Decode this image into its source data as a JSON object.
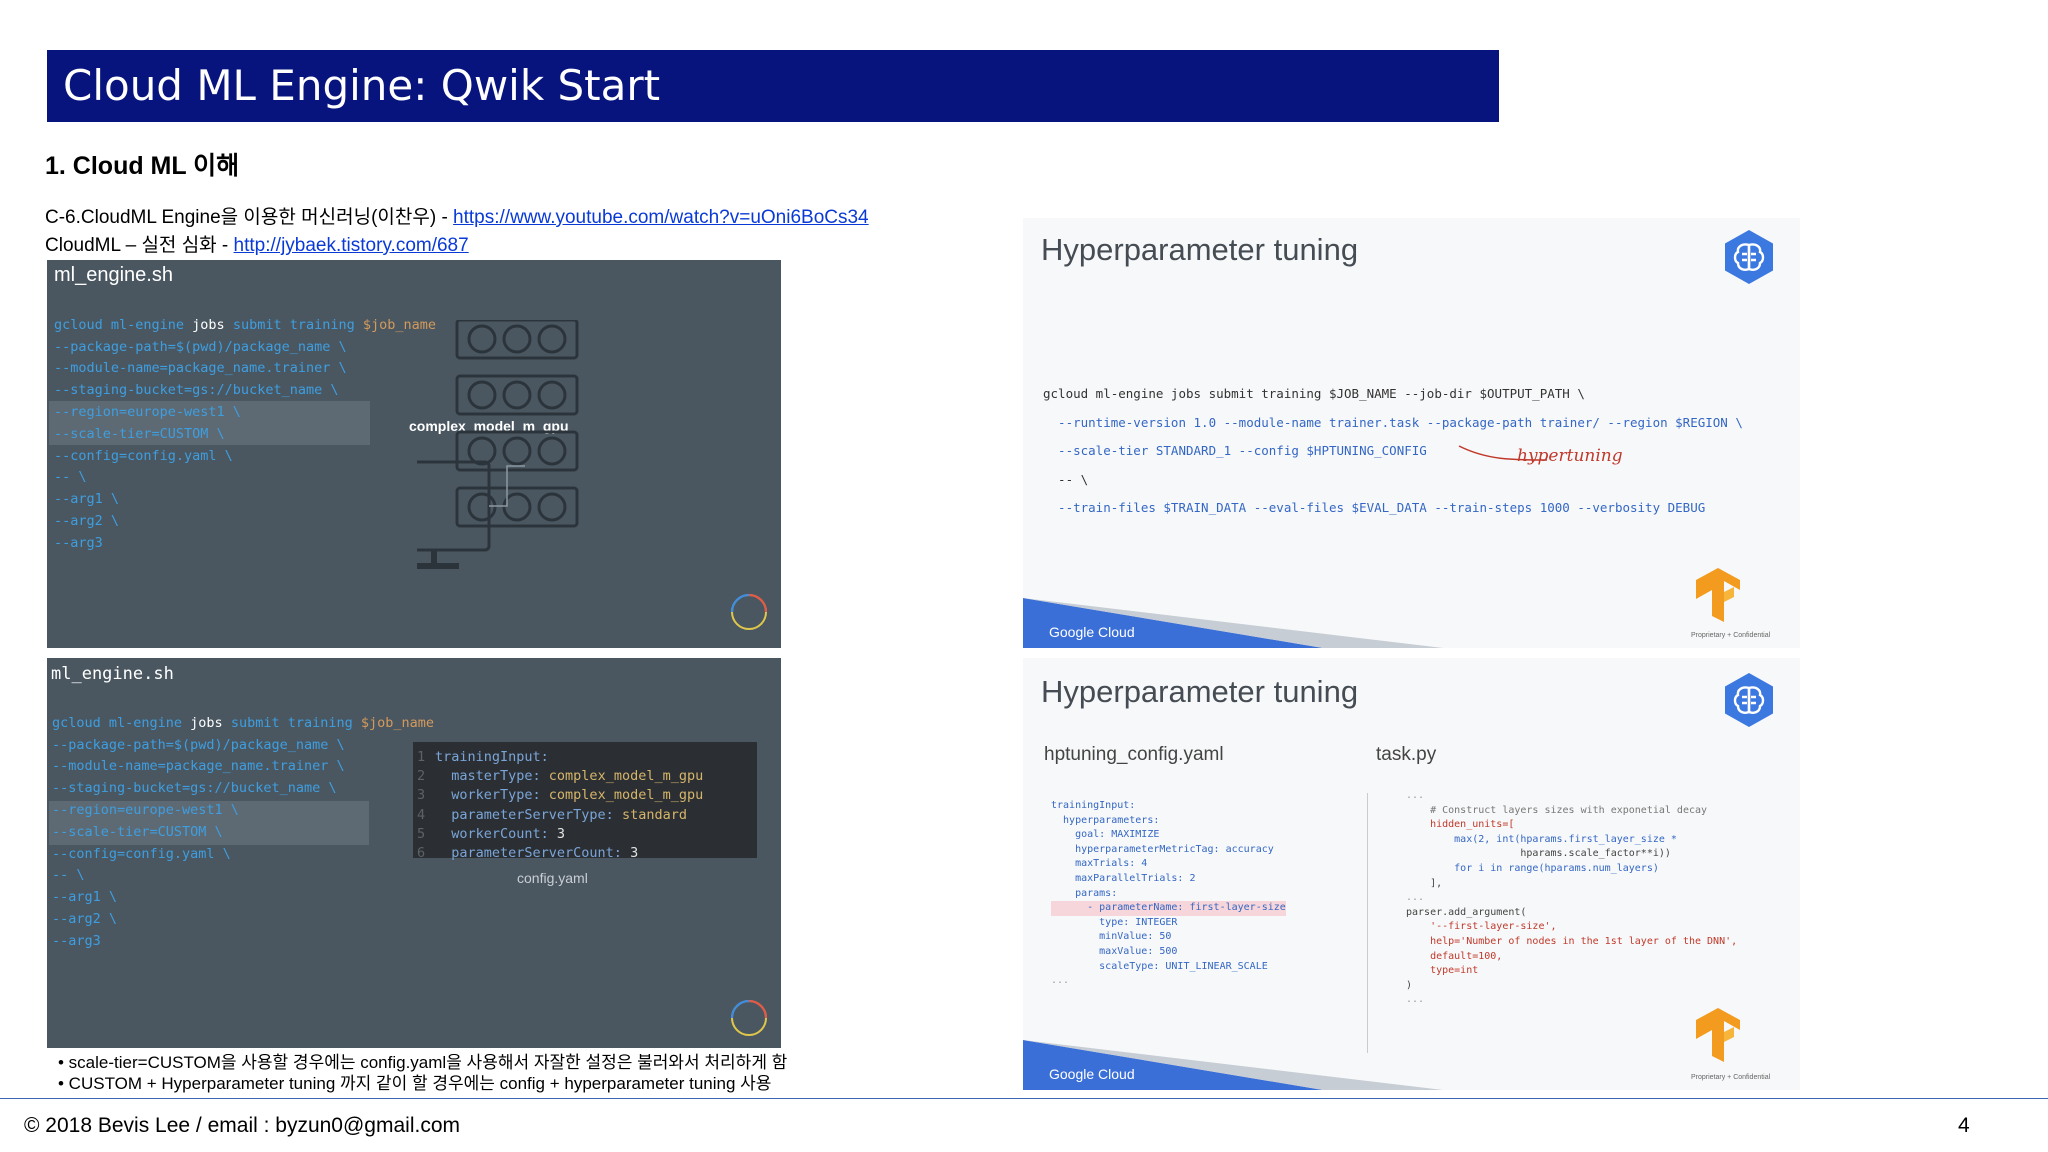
{
  "title": "Cloud ML Engine: Qwik Start",
  "section": "1. Cloud ML 이해",
  "refs": [
    {
      "prefix": "C-6.CloudML Engine을 이용한 머신러닝(이찬우) - ",
      "link": "https://www.youtube.com/watch?v=uOni6BoCs34"
    },
    {
      "prefix": "CloudML – 실전 심화 - ",
      "link": "http://jybaek.tistory.com/687"
    }
  ],
  "panel1": {
    "filename": "ml_engine.sh",
    "lines": [
      {
        "a": "gcloud ml-engine ",
        "w": "jobs",
        "b": " submit training ",
        "v": "$job_name"
      },
      {
        "a": "--package-path=$(pwd)/package_name \\"
      },
      {
        "a": "--module-name=package_name.trainer \\"
      },
      {
        "a": "--staging-bucket=gs://bucket_name \\"
      },
      {
        "a": "--region=europe-west1 \\"
      },
      {
        "a": "--scale-tier=CUSTOM \\"
      },
      {
        "a": "--config=config.yaml \\"
      },
      {
        "a": "-- \\"
      },
      {
        "a": "--arg1 \\"
      },
      {
        "a": "--arg2 \\"
      },
      {
        "a": "--arg3"
      }
    ],
    "machine_label": "complex_model_m_gpu"
  },
  "panel2": {
    "filename": "ml_engine.sh",
    "lines": [
      {
        "a": "gcloud ml-engine ",
        "w": "jobs",
        "b": " submit training ",
        "v": "$job_name"
      },
      {
        "a": "--package-path=$(pwd)/package_name \\"
      },
      {
        "a": "--module-name=package_name.trainer \\"
      },
      {
        "a": "--staging-bucket=gs://bucket_name \\"
      },
      {
        "a": "--region=europe-west1 \\"
      },
      {
        "a": "--scale-tier=CUSTOM \\"
      },
      {
        "a": "--config=config.yaml \\"
      },
      {
        "a": "-- \\"
      },
      {
        "a": "--arg1 \\"
      },
      {
        "a": "--arg2 \\"
      },
      {
        "a": "--arg3"
      }
    ],
    "yaml_lines": [
      {
        "n": "1",
        "k": "trainingInput:",
        "v": ""
      },
      {
        "n": "2",
        "k": "  masterType: ",
        "v": "complex_model_m_gpu"
      },
      {
        "n": "3",
        "k": "  workerType: ",
        "v": "complex_model_m_gpu"
      },
      {
        "n": "4",
        "k": "  parameterServerType: ",
        "v": "standard"
      },
      {
        "n": "5",
        "k": "  workerCount: ",
        "v": "3"
      },
      {
        "n": "6",
        "k": "  parameterServerCount: ",
        "v": "3"
      }
    ],
    "yaml_caption": "config.yaml"
  },
  "slide1": {
    "title": "Hyperparameter tuning",
    "cmd": [
      "gcloud ml-engine jobs submit training $JOB_NAME --job-dir $OUTPUT_PATH \\",
      "  --runtime-version 1.0 --module-name trainer.task --package-path trainer/ --region $REGION \\",
      "  --scale-tier STANDARD_1 --config $HPTUNING_CONFIG",
      "  -- \\",
      "  --train-files $TRAIN_DATA --eval-files $EVAL_DATA --train-steps 1000 --verbosity DEBUG"
    ],
    "annotation": "hypertuning",
    "footer_brand": "Google Cloud",
    "confidential": "Proprietary + Confidential"
  },
  "slide2": {
    "title": "Hyperparameter tuning",
    "left_label": "hptuning_config.yaml",
    "right_label": "task.py",
    "yaml": [
      "trainingInput:",
      "  hyperparameters:",
      "    goal: MAXIMIZE",
      "    hyperparameterMetricTag: accuracy",
      "    maxTrials: 4",
      "    maxParallelTrials: 2",
      "    params:",
      "      - parameterName: first-layer-size",
      "        type: INTEGER",
      "        minValue: 50",
      "        maxValue: 500",
      "        scaleType: UNIT_LINEAR_SCALE",
      "",
      "..."
    ],
    "py": [
      "...",
      "",
      "    # Construct layers sizes with exponetial decay",
      "    hidden_units=[",
      "        max(2, int(hparams.first_layer_size *",
      "                   hparams.scale_factor**i))",
      "        for i in range(hparams.num_layers)",
      "    ],",
      "",
      "...",
      "",
      "parser.add_argument(",
      "    '--first-layer-size',",
      "    help='Number of nodes in the 1st layer of the DNN',",
      "    default=100,",
      "    type=int",
      ")",
      "",
      "..."
    ],
    "footer_brand": "Google Cloud",
    "confidential": "Proprietary + Confidential"
  },
  "bullets": [
    "• scale-tier=CUSTOM을 사용할 경우에는 config.yaml을 사용해서 자잘한 설정은 불러와서 처리하게 함",
    "• CUSTOM + Hyperparameter tuning 까지 같이 할 경우에는 config + hyperparameter tuning 사용"
  ],
  "footer": "© 2018 Bevis Lee   / email : byzun0@gmail.com",
  "page_number": "4",
  "colors": {
    "title_bar": "#07147e",
    "panel_bg": "#4a5761",
    "code_blue": "#3e9ee0",
    "link": "#0a3ad6",
    "gc_blue": "#3b6fd8"
  }
}
